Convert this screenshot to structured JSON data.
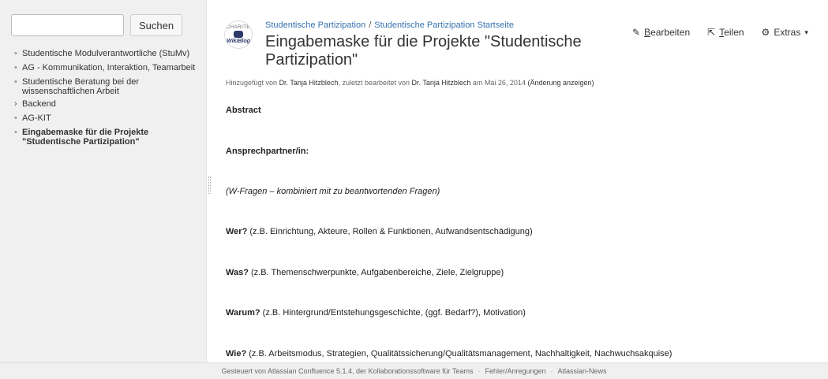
{
  "sidebar": {
    "search": {
      "placeholder": "",
      "button_label": "Suchen"
    },
    "items": [
      {
        "bullet": "•",
        "label": "Studentische Modulverantwortliche (StuMv)"
      },
      {
        "bullet": "•",
        "label": "AG - Kommunikation, Interaktion, Teamarbeit"
      },
      {
        "bullet": "•",
        "label": "Studentische Beratung bei der wissenschaftlichen Arbeit"
      },
      {
        "bullet": "›",
        "label": "Backend"
      },
      {
        "bullet": "•",
        "label": "AG-KIT"
      },
      {
        "bullet": "•",
        "label": "Eingabemaske für die Projekte \"Studentische Partizipation\""
      }
    ]
  },
  "logo": {
    "top": "CHARITÉ",
    "bottom": "WikiBlog"
  },
  "breadcrumb": {
    "items": [
      "Studentische Partizipation",
      "Studentische Partizipation Startseite"
    ],
    "separator": "/"
  },
  "page": {
    "title": "Eingabemaske für die Projekte \"Studentische Partizipation\""
  },
  "actions": {
    "edit": {
      "icon": "pencil-icon",
      "first": "B",
      "rest": "earbeiten"
    },
    "share": {
      "icon": "share-icon",
      "first": "T",
      "rest": "eilen"
    },
    "tools": {
      "icon": "gear-icon",
      "label": "Extras",
      "caret": "▾"
    }
  },
  "meta": {
    "added_by_prefix": "Hinzugefügt von",
    "author": "Dr. Tanja Hitzblech",
    "edited_prefix": ", zuletzt bearbeitet von",
    "editor": "Dr. Tanja Hitzblech",
    "date_prefix": "am Mai 26, 2014",
    "changes_link": "(Änderung anzeigen)"
  },
  "content": {
    "abstract": "Abstract",
    "contact": "Ansprechpartner/in:",
    "w_questions": "(W-Fragen – kombiniert mit zu beantwortenden Fragen)",
    "wer": {
      "q": "Wer?",
      "a": " (z.B. Einrichtung, Akteure, Rollen & Funktionen, Aufwandsentschädigung)"
    },
    "was": {
      "q": "Was?",
      "a": " (z.B. Themenschwerpunkte, Aufgabenbereiche, Ziele, Zielgruppe)"
    },
    "warum": {
      "q": "Warum?",
      "a": " (z.B. Hintergrund/Entstehungsgeschichte, (ggf. Bedarf?), Motivation)"
    },
    "wie": {
      "q": "Wie?",
      "a": " (z.B. Arbeitsmodus, Strategien, Qualitätssicherung/Qualitätsmanagement, Nachhaltigkeit, Nachwuchsakquise)"
    }
  },
  "footer": {
    "powered": "Gesteuert von Atlassian Confluence 5.1.4, der Kollaborationssoftware für Teams",
    "feedback": "Fehler/Anregungen",
    "news": "Atlassian-News",
    "sep": "·"
  }
}
